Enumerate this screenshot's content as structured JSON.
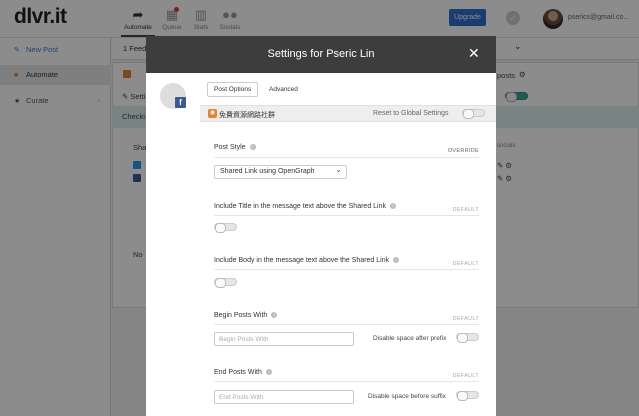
{
  "app": {
    "logo": "dlvr.it"
  },
  "nav": {
    "tabs": [
      {
        "label": "Automate",
        "icon": "share-arrow-icon"
      },
      {
        "label": "Queue",
        "icon": "calendar-icon"
      },
      {
        "label": "Stats",
        "icon": "bar-chart-icon"
      },
      {
        "label": "Socials",
        "icon": "people-icon"
      }
    ],
    "upgrade_label": "Upgrade",
    "user_email": "pserics@gmail.co..."
  },
  "sidebar": {
    "items": [
      {
        "label": "New Post",
        "icon": "pencil-icon"
      },
      {
        "label": "Automate",
        "icon": "rss-icon"
      },
      {
        "label": "Curate",
        "icon": "star-icon"
      }
    ]
  },
  "background": {
    "feeds_label": "1 Feed",
    "sett_label": "Setti",
    "posts_label": "posts",
    "check_label": "Checki",
    "share_label": "Shar",
    "socials_label": "socials",
    "no_label": "No"
  },
  "modal": {
    "title": "Settings for Pseric Lin",
    "close_glyph": "✕",
    "tabs": [
      "Post Options",
      "Advanced"
    ],
    "feed_name": "免費資源網路社群",
    "reset_label": "Reset to Global Settings",
    "sections": {
      "post_style": {
        "label": "Post Style",
        "tag": "OVERRIDE",
        "value": "Shared Link using OpenGraph"
      },
      "include_title": {
        "label": "Include Title in the message text above the Shared Link",
        "tag": "DEFAULT"
      },
      "include_body": {
        "label": "Include Body in the message text above the Shared Link",
        "tag": "DEFAULT"
      },
      "begin_posts": {
        "label": "Begin Posts With",
        "tag": "DEFAULT",
        "placeholder": "Begin Posts With",
        "side_label": "Disable space after prefix"
      },
      "end_posts": {
        "label": "End Posts With",
        "tag": "DEFAULT",
        "placeholder": "End Posts With",
        "side_label": "Disable space before suffix"
      }
    }
  }
}
